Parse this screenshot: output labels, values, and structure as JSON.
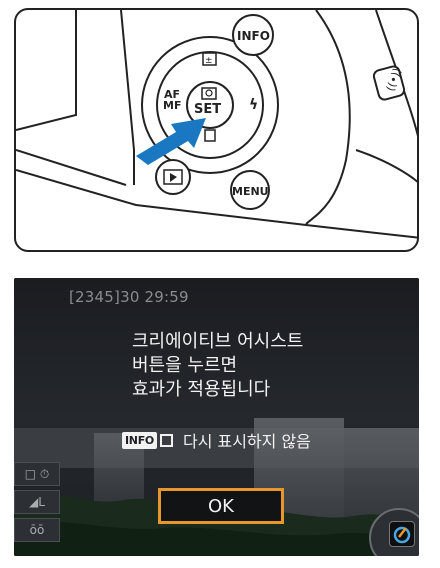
{
  "illustration": {
    "info_button": "INFO",
    "menu_button": "MENU",
    "dial_set": "SET",
    "dial_left": "AF\nMF",
    "play_icon": "play-icon",
    "trash_icon": "trash-icon",
    "flash_icon": "flash-icon",
    "exposure_icon": "exposure-comp-icon",
    "arrow_color": "#1a78c2"
  },
  "screen": {
    "status": "[2345]30 29:59",
    "message_lines": [
      "크리에이티브 어시스트",
      "버튼을 누르면",
      "효과가 적용됩니다"
    ],
    "info_badge": "INFO",
    "noshow_label": "다시 표시하지 않음",
    "ok_label": "OK",
    "side_icons": [
      "□ ⏱",
      "◢L",
      "ōō"
    ],
    "ok_border_color": "#e7972c"
  }
}
